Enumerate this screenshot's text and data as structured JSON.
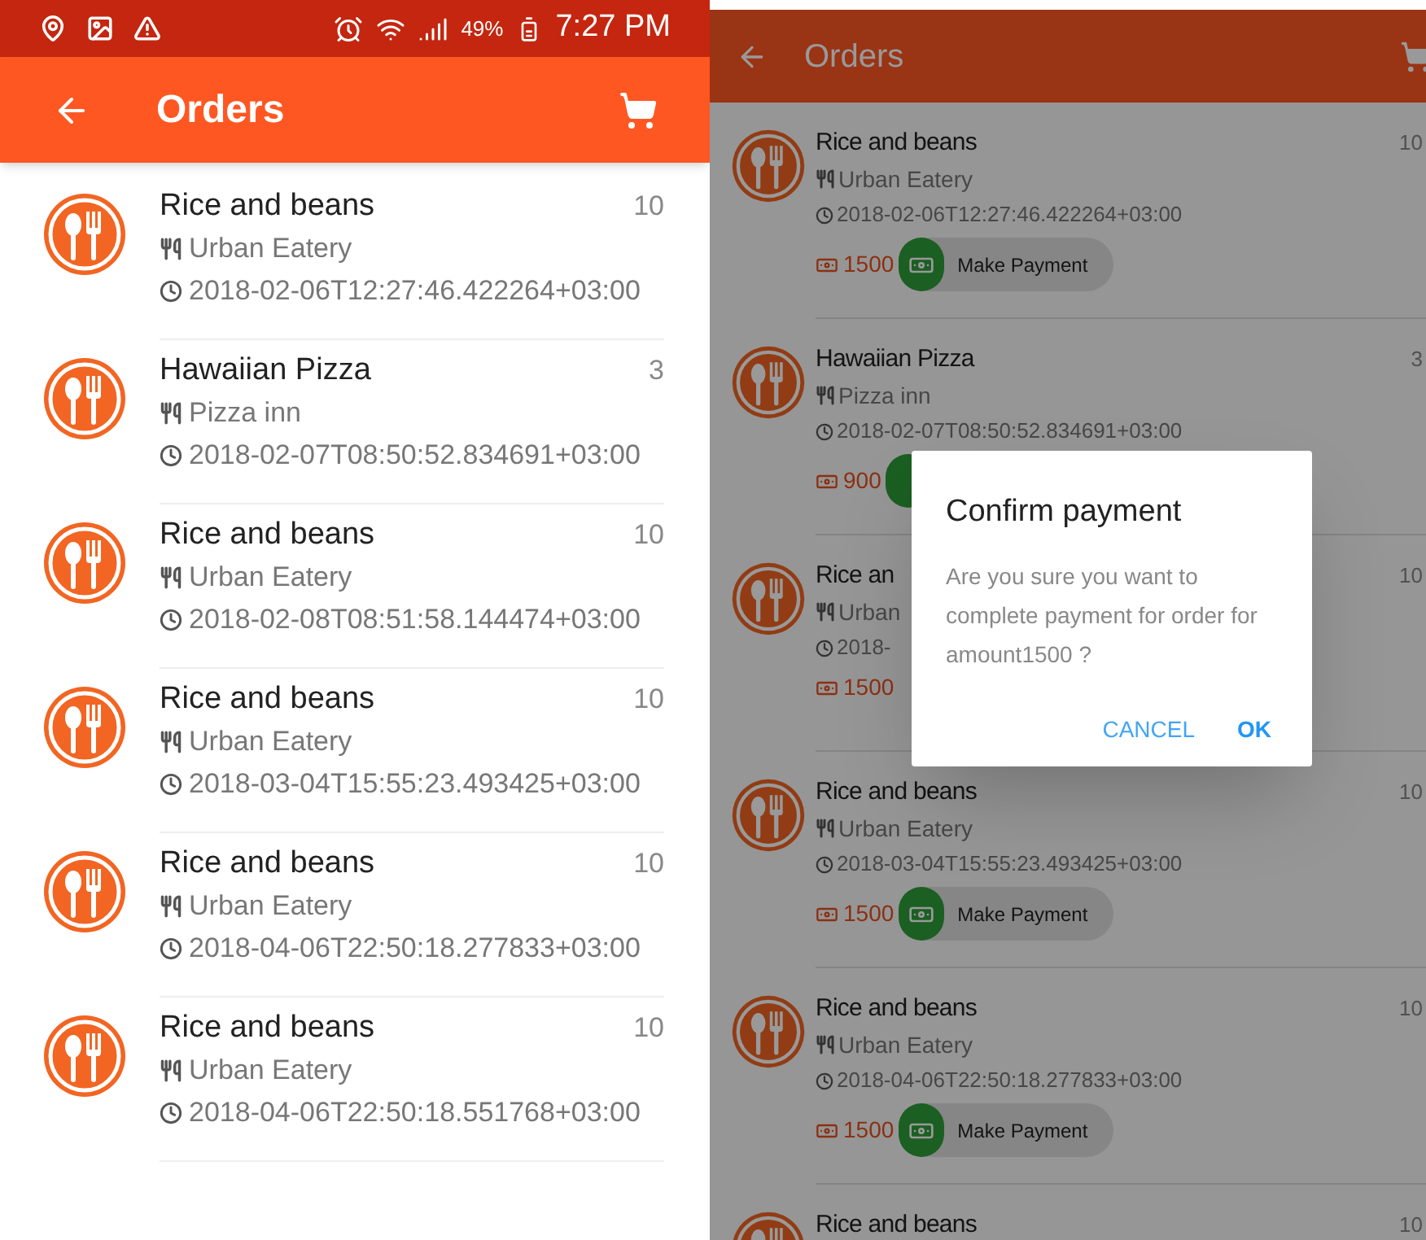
{
  "left_screen": {
    "status_bar": {
      "battery": "49%",
      "time": "7:27 PM"
    },
    "app_bar": {
      "title": "Orders"
    },
    "orders": [
      {
        "title": "Rice and beans",
        "quantity": "10",
        "restaurant": "Urban Eatery",
        "time": "2018-02-06T12:27:46.422264+03:00"
      },
      {
        "title": "Hawaiian Pizza",
        "quantity": "3",
        "restaurant": "Pizza inn",
        "time": "2018-02-07T08:50:52.834691+03:00"
      },
      {
        "title": "Rice and beans",
        "quantity": "10",
        "restaurant": "Urban Eatery",
        "time": "2018-02-08T08:51:58.144474+03:00"
      },
      {
        "title": "Rice and beans",
        "quantity": "10",
        "restaurant": "Urban Eatery",
        "time": "2018-03-04T15:55:23.493425+03:00"
      },
      {
        "title": "Rice and beans",
        "quantity": "10",
        "restaurant": "Urban Eatery",
        "time": "2018-04-06T22:50:18.277833+03:00"
      },
      {
        "title": "Rice and beans",
        "quantity": "10",
        "restaurant": "Urban Eatery",
        "time": "2018-04-06T22:50:18.551768+03:00"
      }
    ]
  },
  "right_screen": {
    "app_bar": {
      "title": "Orders"
    },
    "orders": [
      {
        "title": "Rice and beans",
        "quantity": "10",
        "restaurant": "Urban Eatery",
        "time": "2018-02-06T12:27:46.422264+03:00",
        "price": "1500",
        "pay_label": "Make Payment"
      },
      {
        "title": "Hawaiian Pizza",
        "quantity": "3",
        "restaurant": "Pizza inn",
        "time": "2018-02-07T08:50:52.834691+03:00",
        "price": "900",
        "pay_icon": true
      },
      {
        "title": "Rice an",
        "quantity": "10",
        "restaurant": "Urban",
        "time": "2018-",
        "price": "1500"
      },
      {
        "title": "Rice and beans",
        "quantity": "10",
        "restaurant": "Urban Eatery",
        "time": "2018-03-04T15:55:23.493425+03:00",
        "price": "1500",
        "pay_label": "Make Payment"
      },
      {
        "title": "Rice and beans",
        "quantity": "10",
        "restaurant": "Urban Eatery",
        "time": "2018-04-06T22:50:18.277833+03:00",
        "price": "1500",
        "pay_label": "Make Payment"
      },
      {
        "title": "Rice and beans",
        "quantity": "10"
      }
    ],
    "dialog": {
      "title": "Confirm payment",
      "message": "Are you sure you want to complete payment for order for amount1500 ?",
      "buttons": [
        {
          "label": "CANCEL",
          "kind": "secondary"
        },
        {
          "label": "OK",
          "kind": "primary"
        }
      ]
    }
  }
}
